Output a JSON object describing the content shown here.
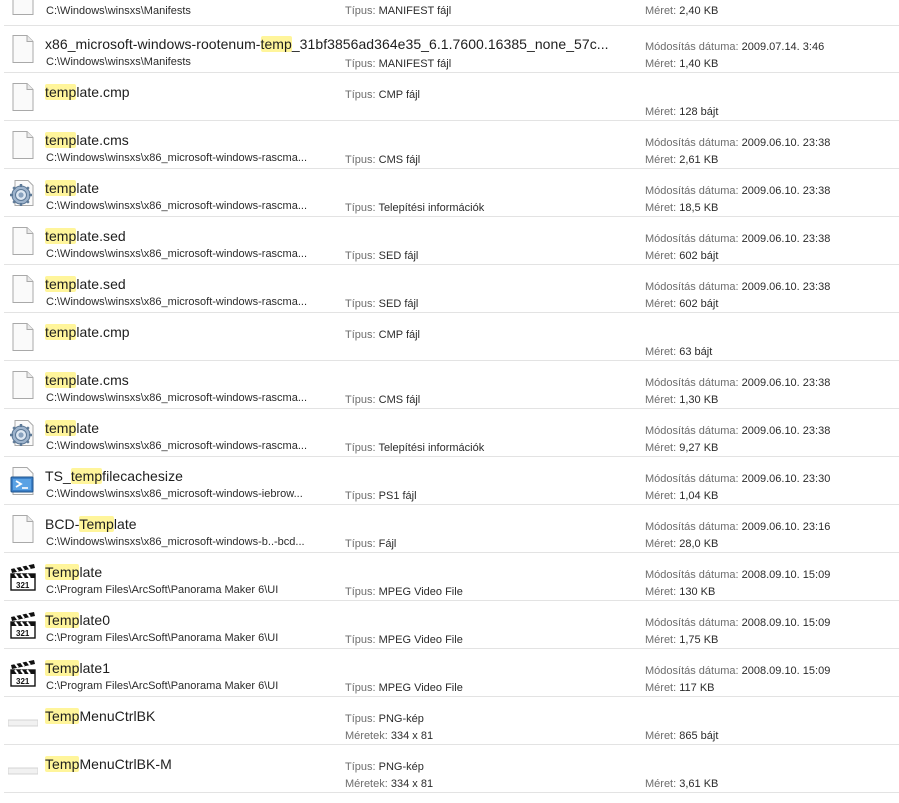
{
  "labels": {
    "type": "Típus:",
    "size": "Méret:",
    "modified": "Módosítás dátuma:",
    "dimensions": "Méretek:"
  },
  "items": [
    {
      "icon": "blank",
      "name_pre": "",
      "name_hl": "",
      "name_post": "",
      "path": "C:\\Windows\\winsxs\\Manifests",
      "type": "MANIFEST fájl",
      "modified": "",
      "size": "2,40 KB",
      "partial": true
    },
    {
      "icon": "blank",
      "name_pre": "x86_microsoft-windows-rootenum-",
      "name_hl": "temp",
      "name_post": "_31bf3856ad364e35_6.1.7600.16385_none_57c...",
      "path": "C:\\Windows\\winsxs\\Manifests",
      "type": "MANIFEST fájl",
      "modified": "2009.07.14. 3:46",
      "size": "1,40 KB"
    },
    {
      "icon": "blank",
      "name_pre": "",
      "name_hl": "temp",
      "name_post": "late.cmp",
      "path": "",
      "type": "CMP fájl",
      "modified": "",
      "size": "128 bájt"
    },
    {
      "icon": "blank",
      "name_pre": "",
      "name_hl": "temp",
      "name_post": "late.cms",
      "path": "C:\\Windows\\winsxs\\x86_microsoft-windows-rascma...",
      "type": "CMS fájl",
      "modified": "2009.06.10. 23:38",
      "size": "2,61 KB"
    },
    {
      "icon": "settings",
      "name_pre": "",
      "name_hl": "temp",
      "name_post": "late",
      "path": "C:\\Windows\\winsxs\\x86_microsoft-windows-rascma...",
      "type": "Telepítési információk",
      "modified": "2009.06.10. 23:38",
      "size": "18,5 KB"
    },
    {
      "icon": "blank",
      "name_pre": "",
      "name_hl": "temp",
      "name_post": "late.sed",
      "path": "C:\\Windows\\winsxs\\x86_microsoft-windows-rascma...",
      "type": "SED fájl",
      "modified": "2009.06.10. 23:38",
      "size": "602 bájt"
    },
    {
      "icon": "blank",
      "name_pre": "",
      "name_hl": "temp",
      "name_post": "late.sed",
      "path": "C:\\Windows\\winsxs\\x86_microsoft-windows-rascma...",
      "type": "SED fájl",
      "modified": "2009.06.10. 23:38",
      "size": "602 bájt"
    },
    {
      "icon": "blank",
      "name_pre": "",
      "name_hl": "temp",
      "name_post": "late.cmp",
      "path": "",
      "type": "CMP fájl",
      "modified": "",
      "size": "63 bájt"
    },
    {
      "icon": "blank",
      "name_pre": "",
      "name_hl": "temp",
      "name_post": "late.cms",
      "path": "C:\\Windows\\winsxs\\x86_microsoft-windows-rascma...",
      "type": "CMS fájl",
      "modified": "2009.06.10. 23:38",
      "size": "1,30 KB"
    },
    {
      "icon": "settings",
      "name_pre": "",
      "name_hl": "temp",
      "name_post": "late",
      "path": "C:\\Windows\\winsxs\\x86_microsoft-windows-rascma...",
      "type": "Telepítési információk",
      "modified": "2009.06.10. 23:38",
      "size": "9,27 KB"
    },
    {
      "icon": "powershell",
      "name_pre": "TS_",
      "name_hl": "temp",
      "name_post": "filecachesize",
      "path": "C:\\Windows\\winsxs\\x86_microsoft-windows-iebrow...",
      "type": "PS1 fájl",
      "modified": "2009.06.10. 23:30",
      "size": "1,04 KB"
    },
    {
      "icon": "blank",
      "name_pre": "BCD-",
      "name_hl": "Temp",
      "name_post": "late",
      "path": "C:\\Windows\\winsxs\\x86_microsoft-windows-b..-bcd...",
      "type": "Fájl",
      "modified": "2009.06.10. 23:16",
      "size": "28,0 KB"
    },
    {
      "icon": "video",
      "name_pre": "",
      "name_hl": "Temp",
      "name_post": "late",
      "path": "C:\\Program Files\\ArcSoft\\Panorama Maker 6\\UI",
      "type": "MPEG Video File",
      "modified": "2008.09.10. 15:09",
      "size": "130 KB"
    },
    {
      "icon": "video",
      "name_pre": "",
      "name_hl": "Temp",
      "name_post": "late0",
      "path": "C:\\Program Files\\ArcSoft\\Panorama Maker 6\\UI",
      "type": "MPEG Video File",
      "modified": "2008.09.10. 15:09",
      "size": "1,75 KB"
    },
    {
      "icon": "video",
      "name_pre": "",
      "name_hl": "Temp",
      "name_post": "late1",
      "path": "C:\\Program Files\\ArcSoft\\Panorama Maker 6\\UI",
      "type": "MPEG Video File",
      "modified": "2008.09.10. 15:09",
      "size": "117 KB"
    },
    {
      "icon": "image",
      "name_pre": "",
      "name_hl": "Temp",
      "name_post": "MenuCtrlBK",
      "path": "",
      "type": "PNG-kép",
      "dimensions": "334 x 81",
      "modified": "",
      "size": "865 bájt"
    },
    {
      "icon": "image",
      "name_pre": "",
      "name_hl": "Temp",
      "name_post": "MenuCtrlBK-M",
      "path": "",
      "type": "PNG-kép",
      "dimensions": "334 x 81",
      "modified": "",
      "size": "3,61 KB"
    }
  ]
}
